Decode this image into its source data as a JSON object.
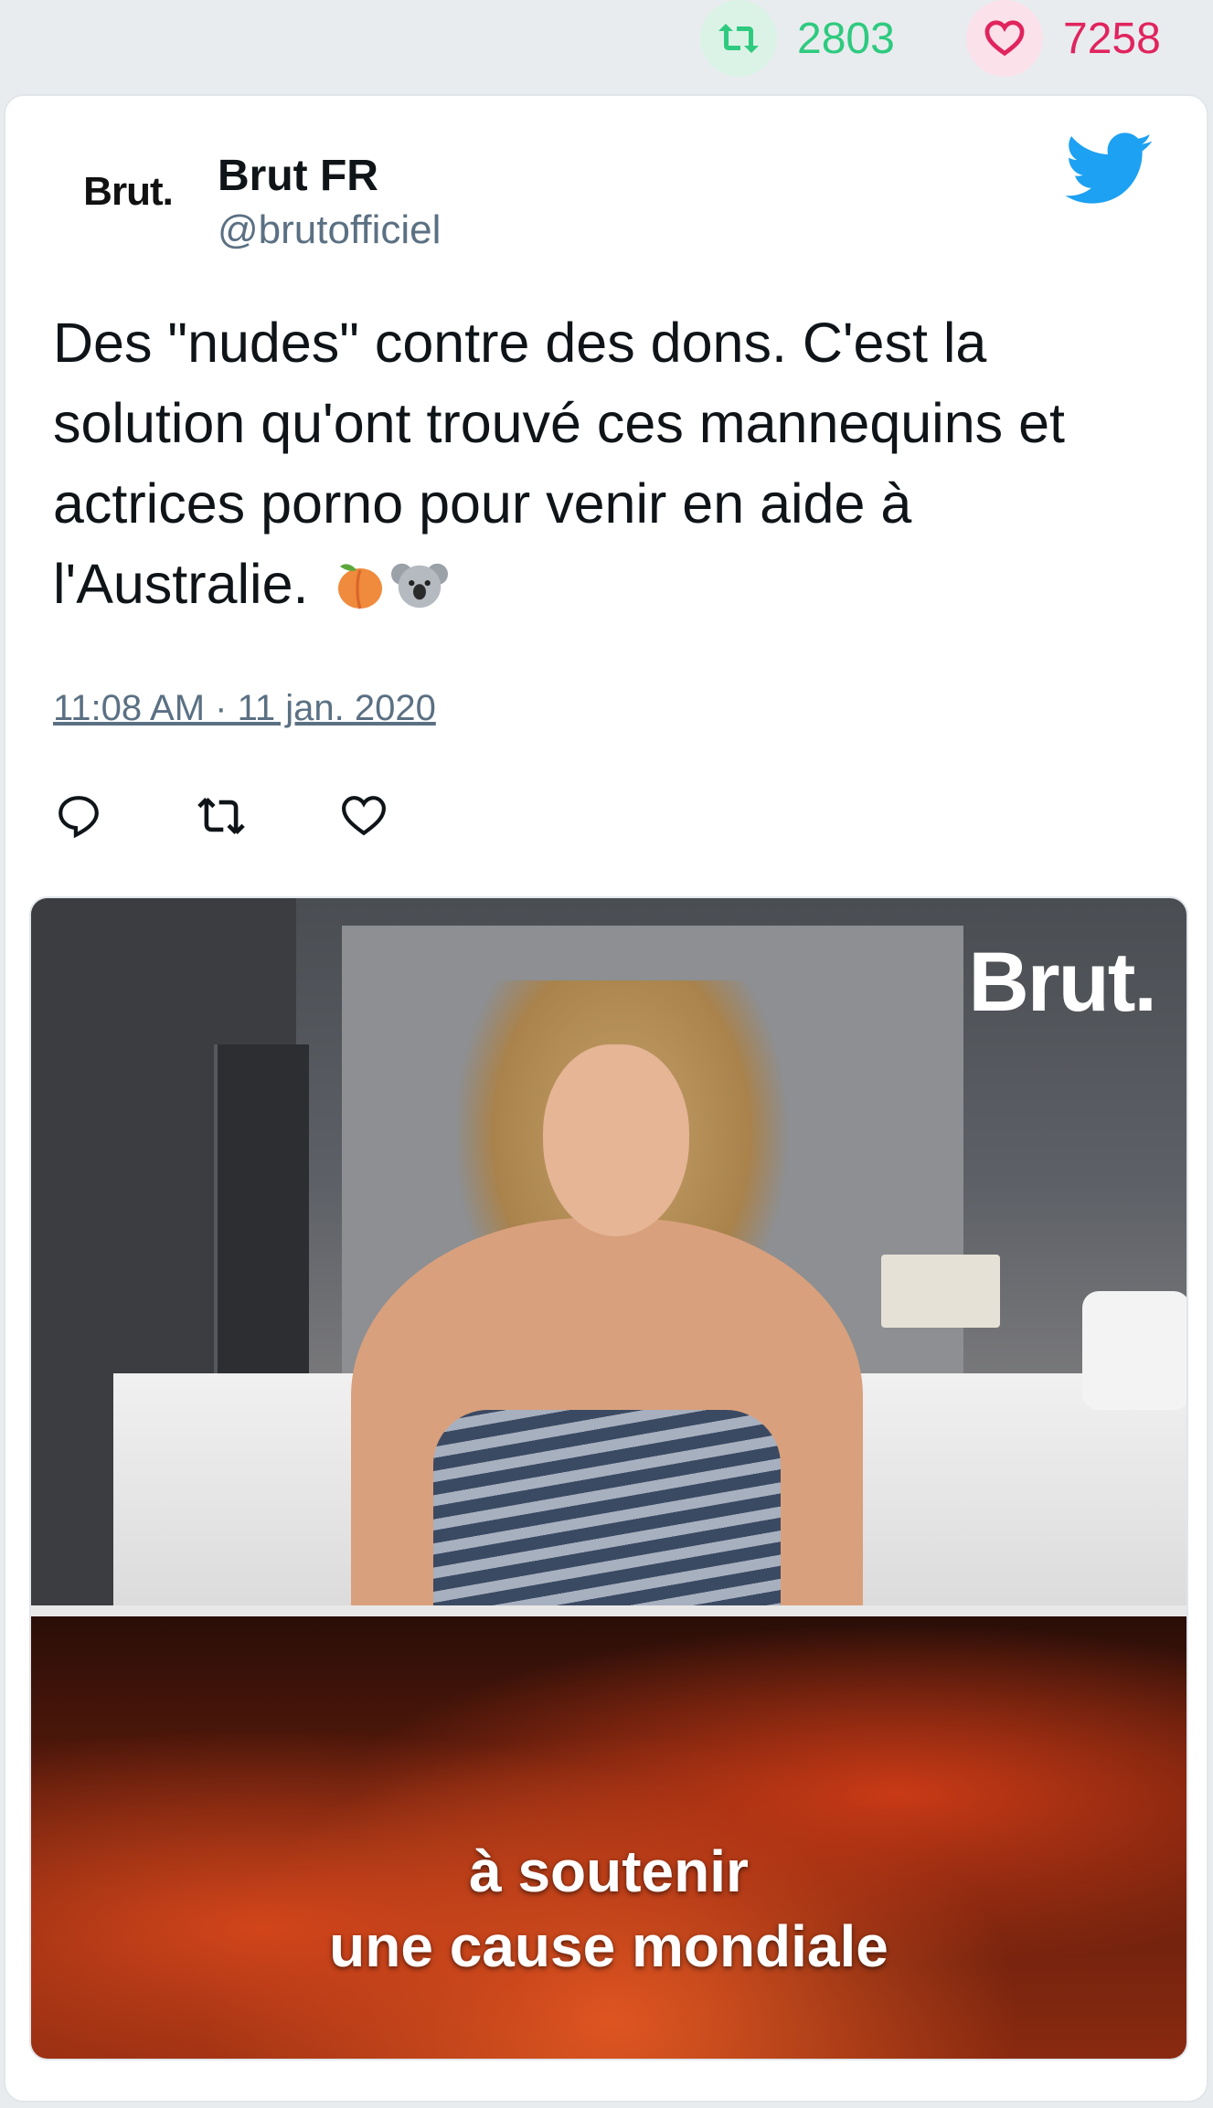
{
  "top_stats": {
    "retweet_count": "2803",
    "like_count": "7258",
    "retweet_color": "#2eca7f",
    "like_color": "#e0245e"
  },
  "tweet": {
    "author_name": "Brut FR",
    "author_handle": "@brutofficiel",
    "avatar_text": "Brut.",
    "text": "Des \"nudes\" contre des dons. C'est la solution qu'ont trouvé ces mannequins et actrices porno pour venir en aide à l'Australie.",
    "emojis": [
      "peach-emoji",
      "koala-emoji"
    ],
    "timestamp": "11:08 AM · 11 jan. 2020",
    "actions": [
      "reply-icon",
      "retweet-icon",
      "like-icon"
    ]
  },
  "media": {
    "logo_text": "Brut.",
    "caption_line1": "à soutenir",
    "caption_line2": "une cause mondiale"
  },
  "colors": {
    "twitter_blue": "#1da1f2",
    "secondary_text": "#5b7083"
  }
}
